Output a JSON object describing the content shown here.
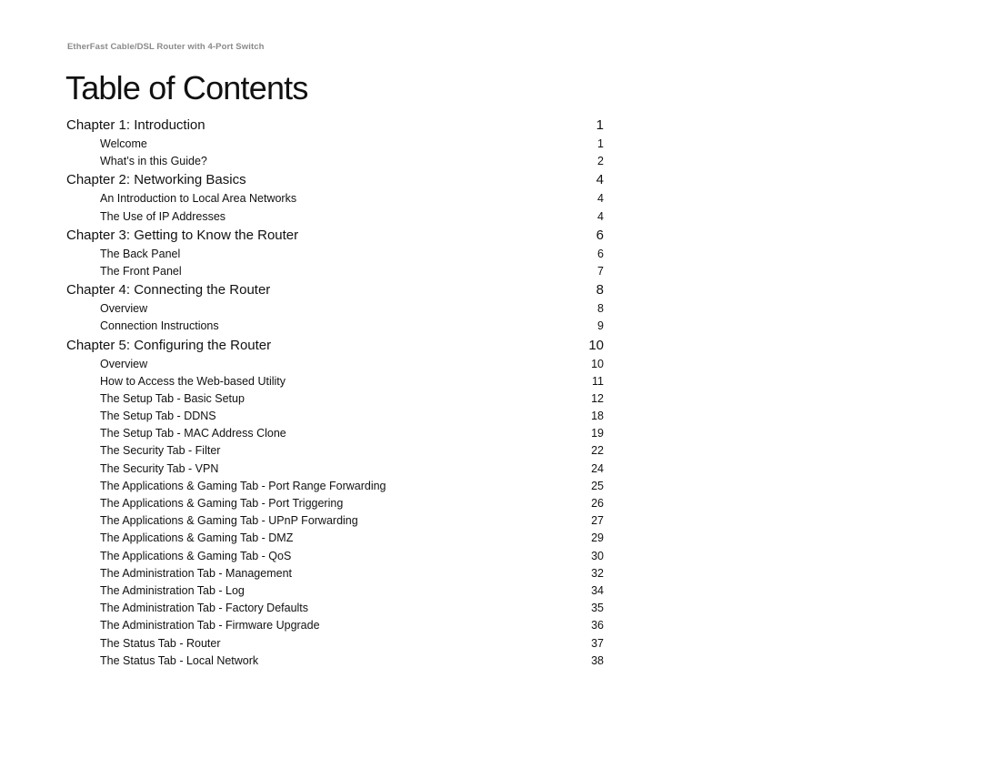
{
  "document": {
    "running_header": "EtherFast Cable/DSL Router with 4-Port Switch",
    "title": "Table of Contents"
  },
  "toc": [
    {
      "type": "chapter",
      "label": "Chapter 1: Introduction",
      "page": "1"
    },
    {
      "type": "section",
      "label": "Welcome",
      "page": "1"
    },
    {
      "type": "section",
      "label": "What’s in this Guide?",
      "page": "2"
    },
    {
      "type": "chapter",
      "label": "Chapter 2: Networking Basics",
      "page": "4"
    },
    {
      "type": "section",
      "label": "An Introduction to Local Area Networks",
      "page": "4"
    },
    {
      "type": "section",
      "label": "The Use of IP Addresses",
      "page": "4"
    },
    {
      "type": "chapter",
      "label": "Chapter 3: Getting to Know the Router",
      "page": "6"
    },
    {
      "type": "section",
      "label": "The Back Panel",
      "page": "6"
    },
    {
      "type": "section",
      "label": "The Front Panel",
      "page": "7"
    },
    {
      "type": "chapter",
      "label": "Chapter 4: Connecting the Router",
      "page": "8"
    },
    {
      "type": "section",
      "label": "Overview",
      "page": "8"
    },
    {
      "type": "section",
      "label": "Connection Instructions",
      "page": "9"
    },
    {
      "type": "chapter",
      "label": "Chapter 5: Configuring the Router",
      "page": "10"
    },
    {
      "type": "section",
      "label": "Overview",
      "page": "10"
    },
    {
      "type": "section",
      "label": "How to Access the Web-based Utility",
      "page": "11"
    },
    {
      "type": "section",
      "label": "The Setup Tab - Basic Setup",
      "page": "12"
    },
    {
      "type": "section",
      "label": "The Setup Tab - DDNS",
      "page": "18"
    },
    {
      "type": "section",
      "label": "The Setup Tab - MAC Address Clone",
      "page": "19"
    },
    {
      "type": "section",
      "label": "The Security Tab - Filter",
      "page": "22"
    },
    {
      "type": "section",
      "label": "The Security Tab - VPN",
      "page": "24"
    },
    {
      "type": "section",
      "label": "The Applications & Gaming Tab - Port Range Forwarding",
      "page": "25"
    },
    {
      "type": "section",
      "label": "The Applications & Gaming Tab - Port Triggering",
      "page": "26"
    },
    {
      "type": "section",
      "label": "The Applications & Gaming Tab - UPnP Forwarding",
      "page": "27"
    },
    {
      "type": "section",
      "label": "The Applications & Gaming Tab - DMZ",
      "page": "29"
    },
    {
      "type": "section",
      "label": "The Applications & Gaming Tab - QoS",
      "page": "30"
    },
    {
      "type": "section",
      "label": "The Administration Tab - Management",
      "page": "32"
    },
    {
      "type": "section",
      "label": "The Administration Tab - Log",
      "page": "34"
    },
    {
      "type": "section",
      "label": "The Administration Tab - Factory Defaults",
      "page": "35"
    },
    {
      "type": "section",
      "label": "The Administration Tab - Firmware Upgrade",
      "page": "36"
    },
    {
      "type": "section",
      "label": "The Status Tab - Router",
      "page": "37"
    },
    {
      "type": "section",
      "label": "The Status Tab - Local Network",
      "page": "38"
    }
  ]
}
